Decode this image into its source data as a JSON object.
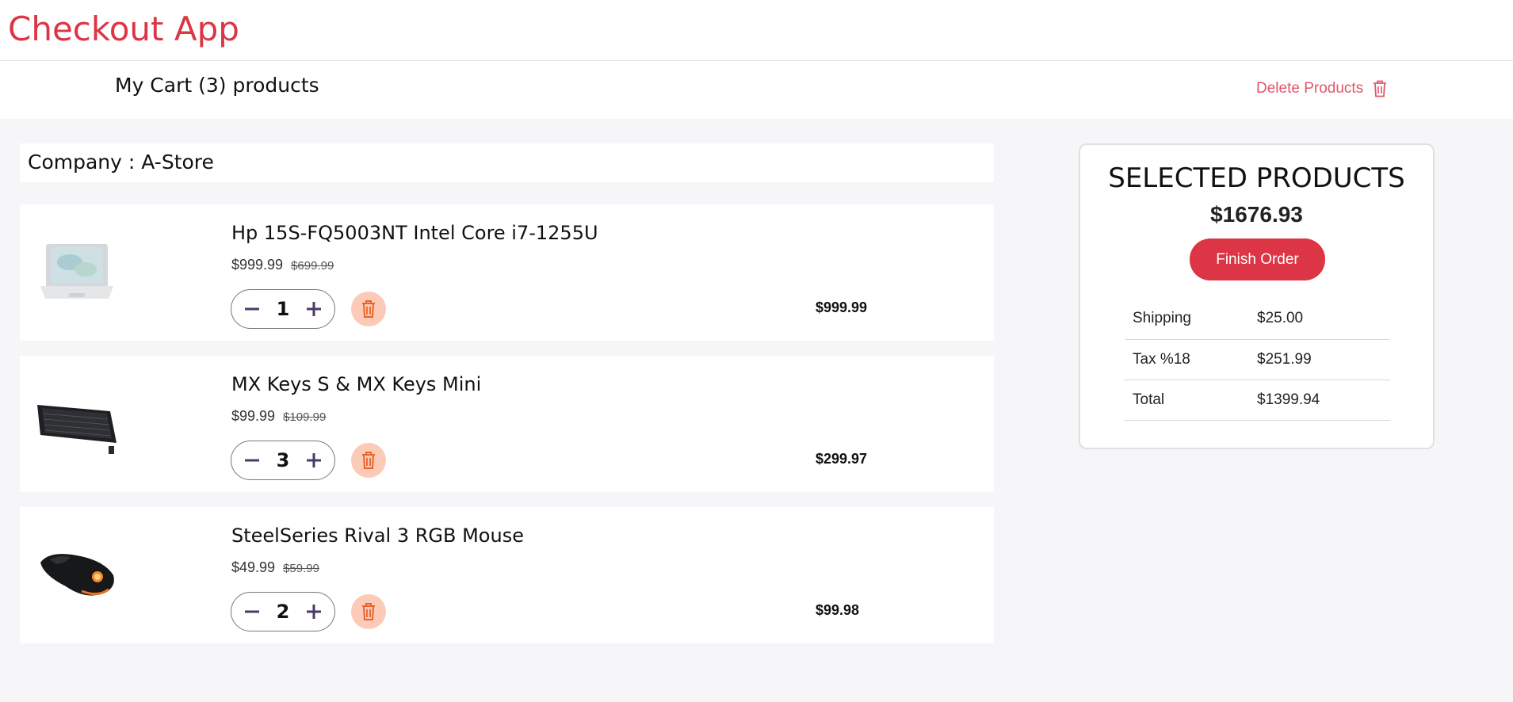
{
  "app": {
    "title": "Checkout App"
  },
  "cart": {
    "title": "My Cart (3) products",
    "delete_label": "Delete Products",
    "company_label": "Company : A-Store"
  },
  "items": [
    {
      "name": "Hp 15S-FQ5003NT Intel Core i7-1255U",
      "price": "$999.99",
      "old_price": "$699.99",
      "qty": "1",
      "total": "$999.99",
      "image": "laptop-image"
    },
    {
      "name": "MX Keys S & MX Keys Mini",
      "price": "$99.99",
      "old_price": "$109.99",
      "qty": "3",
      "total": "$299.97",
      "image": "keyboard-image"
    },
    {
      "name": "SteelSeries Rival 3 RGB Mouse",
      "price": "$49.99",
      "old_price": "$59.99",
      "qty": "2",
      "total": "$99.98",
      "image": "mouse-image"
    }
  ],
  "summary": {
    "title": "SELECTED PRODUCTS",
    "amount": "$1676.93",
    "finish_label": "Finish Order",
    "rows": [
      {
        "label": "Shipping",
        "value": "$25.00"
      },
      {
        "label": "Tax %18",
        "value": "$251.99"
      },
      {
        "label": "Total",
        "value": "$1399.94"
      }
    ]
  },
  "colors": {
    "brand": "#dc3545",
    "accent": "#4a3a6b",
    "trash_bg": "#fccbb7",
    "trash_icon": "#e8632a"
  }
}
